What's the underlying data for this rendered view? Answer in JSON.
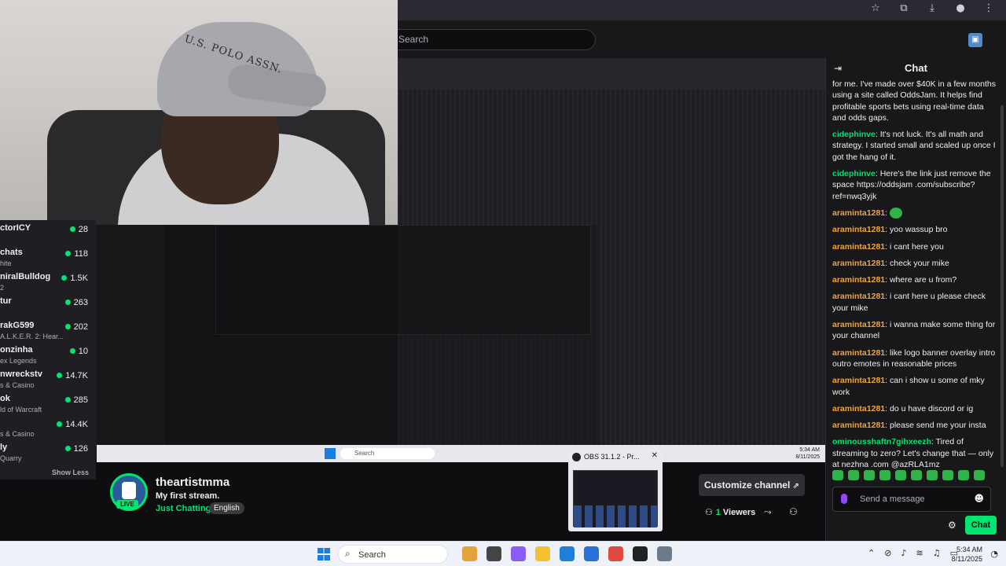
{
  "browser": {
    "search_placeholder": "Search",
    "icons": [
      "star-icon",
      "extension-icon",
      "media-icon",
      "profile-icon",
      "menu-icon"
    ]
  },
  "webcam": {
    "cap_text": "U.S. POLO ASSN."
  },
  "sidebar": {
    "items": [
      {
        "name": "ctorICY",
        "sub": "",
        "count": "28"
      },
      {
        "name": "chats",
        "sub": "hite",
        "count": "118"
      },
      {
        "name": "niralBulldog",
        "sub": "2",
        "count": "1.5K"
      },
      {
        "name": "tur",
        "sub": "",
        "count": "263"
      },
      {
        "name": "rakG599",
        "sub": "A.L.K.E.R. 2: Hear...",
        "count": "202"
      },
      {
        "name": "onzinha",
        "sub": "ex Legends",
        "count": "10"
      },
      {
        "name": "nwreckstv",
        "sub": "s & Casino",
        "count": "14.7K"
      },
      {
        "name": "ok",
        "sub": "ld of Warcraft",
        "count": "285"
      },
      {
        "name": "",
        "sub": "s & Casino",
        "count": "14.4K"
      },
      {
        "name": "ly",
        "sub": "Quarry",
        "count": "126"
      }
    ],
    "show_less": "Show Less"
  },
  "channel": {
    "name": "theartistmma",
    "title": "My first stream.",
    "category": "Just Chatting",
    "language": "English",
    "live_badge": "LIVE",
    "customize_label": "Customize channel",
    "viewers_count": "1",
    "viewers_label": "Viewers"
  },
  "obs": {
    "title": "OBS 31.1.2 - Pr..."
  },
  "chat": {
    "title": "Chat",
    "messages": [
      {
        "user": "",
        "text": "for me. I've made over $40K in a few months using a site called OddsJam. It helps find profitable sports bets using real-time data and odds gaps.",
        "color": "green"
      },
      {
        "user": "cidephinve",
        "text": ": It's not luck. It's all math and strategy. I started small and scaled up once I got the hang of it.",
        "color": "green"
      },
      {
        "user": "cidephinve",
        "text": ": Here's the link just remove the space https://oddsjam .com/subscribe?ref=nwq3yjk",
        "color": "green"
      },
      {
        "user": "araminta1281",
        "text": ":",
        "color": "orange",
        "emote": true
      },
      {
        "user": "araminta1281",
        "text": ": yoo wassup bro",
        "color": "orange"
      },
      {
        "user": "araminta1281",
        "text": ": i cant here you",
        "color": "orange"
      },
      {
        "user": "araminta1281",
        "text": ": check your mike",
        "color": "orange"
      },
      {
        "user": "araminta1281",
        "text": ": where are u from?",
        "color": "orange"
      },
      {
        "user": "araminta1281",
        "text": ": i cant here u please check your mike",
        "color": "orange"
      },
      {
        "user": "araminta1281",
        "text": ": i wanna make some thing for your channel",
        "color": "orange"
      },
      {
        "user": "araminta1281",
        "text": ": like logo banner overlay intro outro emotes in reasonable prices",
        "color": "orange"
      },
      {
        "user": "araminta1281",
        "text": ": can i show u some of mky work",
        "color": "orange"
      },
      {
        "user": "araminta1281",
        "text": ": do u have discord or ig",
        "color": "orange"
      },
      {
        "user": "araminta1281",
        "text": ": please send me your insta",
        "color": "orange"
      },
      {
        "user": "ominousshaftn7gihxeezh",
        "text": ": Tired of streaming to zero? Let's change that — only at nezhna .com @azRLA1mz",
        "color": "green"
      }
    ],
    "input_placeholder": "Send a message",
    "chat_button": "Chat"
  },
  "taskbar": {
    "search_label": "Search",
    "time": "5:34 AM",
    "date": "8/11/2025",
    "apps": [
      "#e3a33a",
      "#444",
      "#8a5cf5",
      "#f2c230",
      "#1f7fd6",
      "#2b6fd8",
      "#e14b3b",
      "#222",
      "#6c7a89"
    ]
  },
  "nested_taskbar": {
    "search_label": "Search",
    "time": "5:34 AM",
    "date": "8/11/2025"
  }
}
